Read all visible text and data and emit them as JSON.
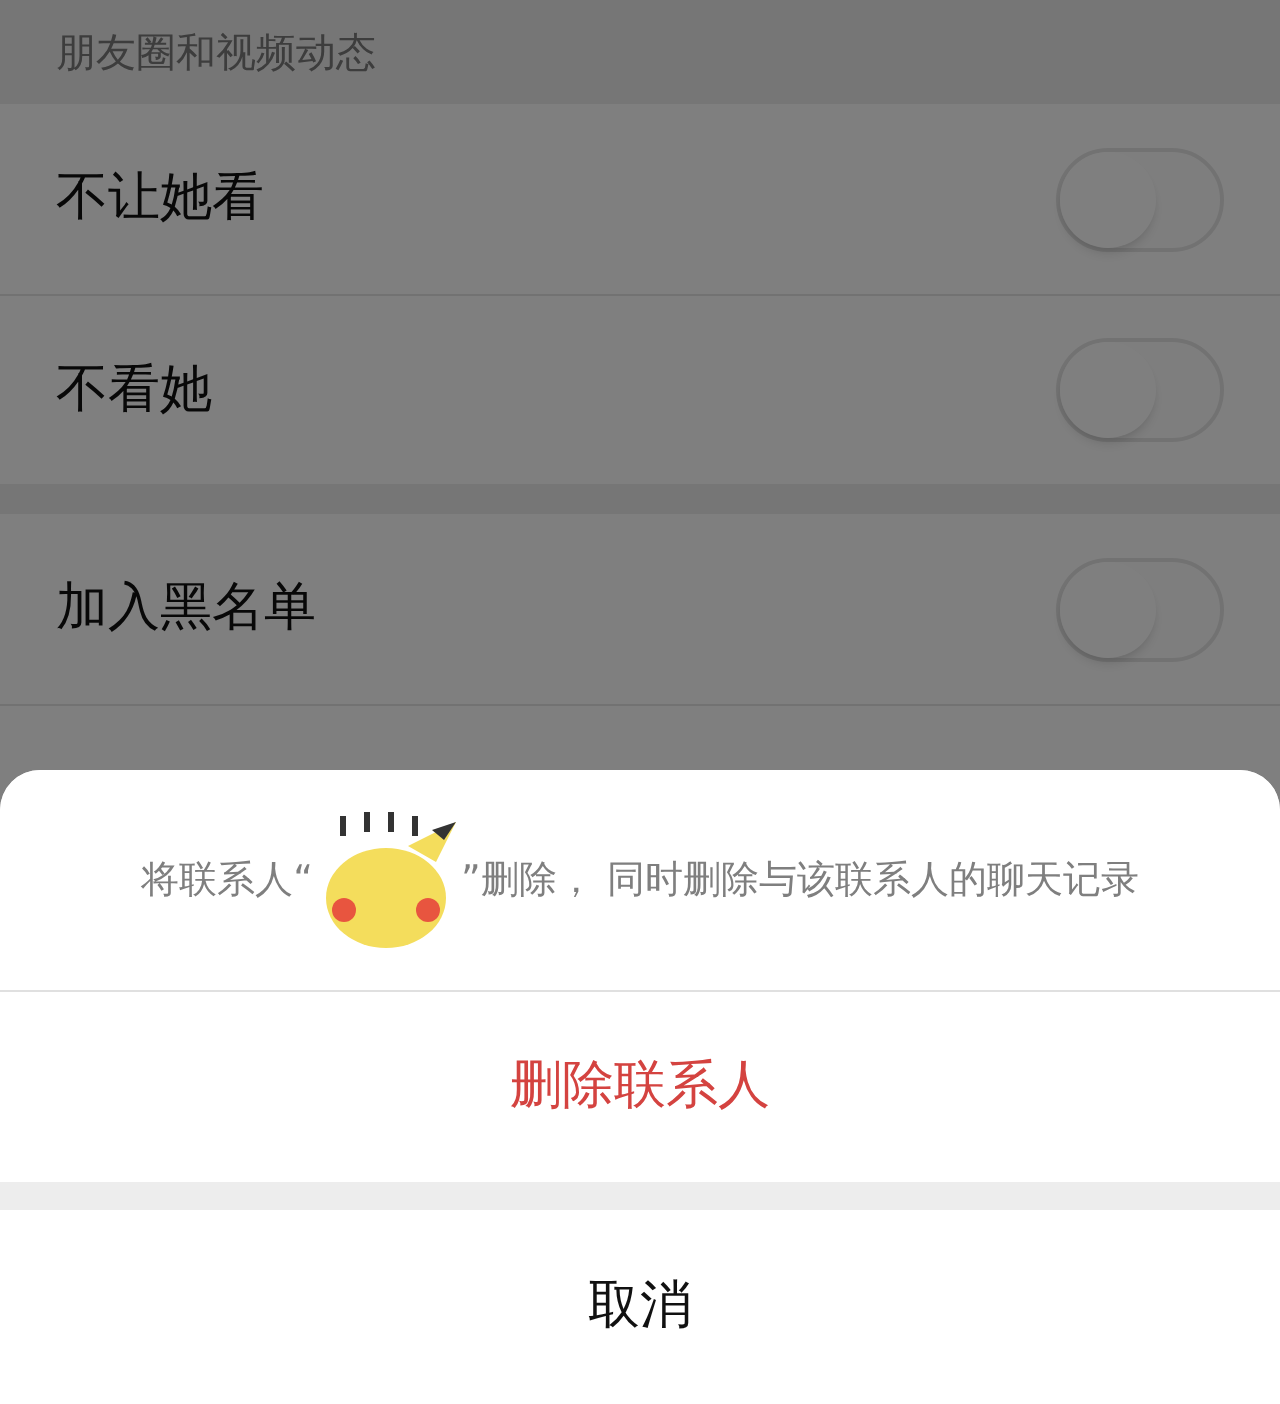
{
  "section_header": "朋友圈和视频动态",
  "groups": [
    [
      {
        "label": "不让她看",
        "on": false
      },
      {
        "label": "不看她",
        "on": false
      }
    ],
    [
      {
        "label": "加入黑名单",
        "on": false
      }
    ]
  ],
  "sheet": {
    "message_before": "将联系人“",
    "message_after": "”删除， 同时删除与该联系人的聊天记录",
    "delete_button": "删除联系人",
    "cancel_button": "取消"
  }
}
